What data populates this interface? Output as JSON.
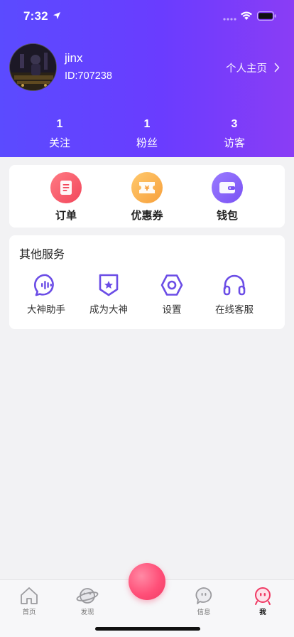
{
  "status_bar": {
    "time": "7:32"
  },
  "profile": {
    "username": "jinx",
    "user_id": "ID:707238",
    "homepage_label": "个人主页"
  },
  "stats": [
    {
      "count": "1",
      "label": "关注"
    },
    {
      "count": "1",
      "label": "粉丝"
    },
    {
      "count": "3",
      "label": "访客"
    }
  ],
  "quick_actions": [
    {
      "label": "订单",
      "icon": "order-icon",
      "color": "#f2465b"
    },
    {
      "label": "优惠券",
      "icon": "coupon-icon",
      "color": "#f7a03c"
    },
    {
      "label": "钱包",
      "icon": "wallet-icon",
      "color": "#7a52f4"
    }
  ],
  "services": {
    "title": "其他服务",
    "items": [
      {
        "label": "大神助手",
        "icon": "voice-assistant-icon"
      },
      {
        "label": "成为大神",
        "icon": "badge-star-icon"
      },
      {
        "label": "设置",
        "icon": "settings-icon"
      },
      {
        "label": "在线客服",
        "icon": "headphones-icon"
      }
    ],
    "icon_color": "#6b4de6"
  },
  "tabbar": {
    "items": [
      {
        "label": "首页",
        "icon": "home-icon"
      },
      {
        "label": "发现",
        "icon": "planet-icon"
      },
      {
        "label": "信息",
        "icon": "message-icon"
      },
      {
        "label": "我",
        "icon": "me-icon",
        "active": true
      }
    ],
    "accent": "#f03a64"
  },
  "colors": {
    "header_gradient_start": "#5b4bff",
    "header_gradient_end": "#8a3df5",
    "background": "#f2f2f4"
  }
}
